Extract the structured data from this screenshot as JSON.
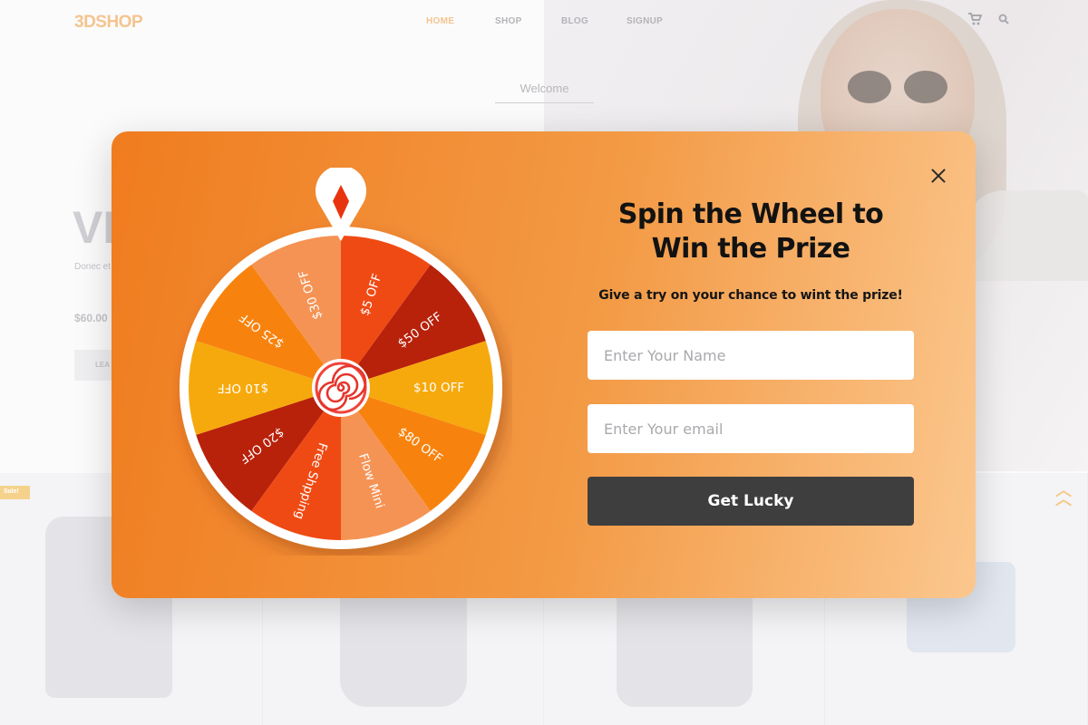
{
  "site": {
    "logo": "3DSHOP",
    "nav": [
      "HOME",
      "SHOP",
      "BLOG",
      "SIGNUP"
    ],
    "active_nav": "HOME",
    "nav_icons": [
      "cart-icon",
      "search-icon"
    ],
    "welcome": "Welcome",
    "hero_title": "VI",
    "hero_text": "Donec et",
    "hero_price": "$60.00",
    "hero_button": "LEA",
    "sale_badge": "Sale!",
    "scroll_top_icon": "chevron-double-up-icon"
  },
  "popup": {
    "title": "Spin the Wheel to Win the Prize",
    "subtitle": "Give a try on your chance to wint the prize!",
    "name_placeholder": "Enter Your Name",
    "email_placeholder": "Enter Your email",
    "button_label": "Get Lucky",
    "close_icon": "close-icon",
    "accent_colors": [
      "#f07c1f",
      "#fbc78e",
      "#3e3e3e"
    ]
  },
  "wheel": {
    "segments": [
      {
        "label": "$5 OFF",
        "color": "#f04a14"
      },
      {
        "label": "$50 OFF",
        "color": "#b8210a"
      },
      {
        "label": "$10 OFF",
        "color": "#f6a90c"
      },
      {
        "label": "$80 OFF",
        "color": "#f7830e"
      },
      {
        "label": "Flow Mini",
        "color": "#f59354"
      },
      {
        "label": "Free Shpping",
        "color": "#f04a14"
      },
      {
        "label": "$20 OFF",
        "color": "#b8210a"
      },
      {
        "label": "$10 OFF",
        "color": "#f6a90c"
      },
      {
        "label": "$25 OFF",
        "color": "#f7830e"
      },
      {
        "label": "$30 OFF",
        "color": "#f59354"
      }
    ],
    "center_icon": "lollipop-swirl-icon",
    "pointer_icon": "pointer-pin-icon"
  }
}
